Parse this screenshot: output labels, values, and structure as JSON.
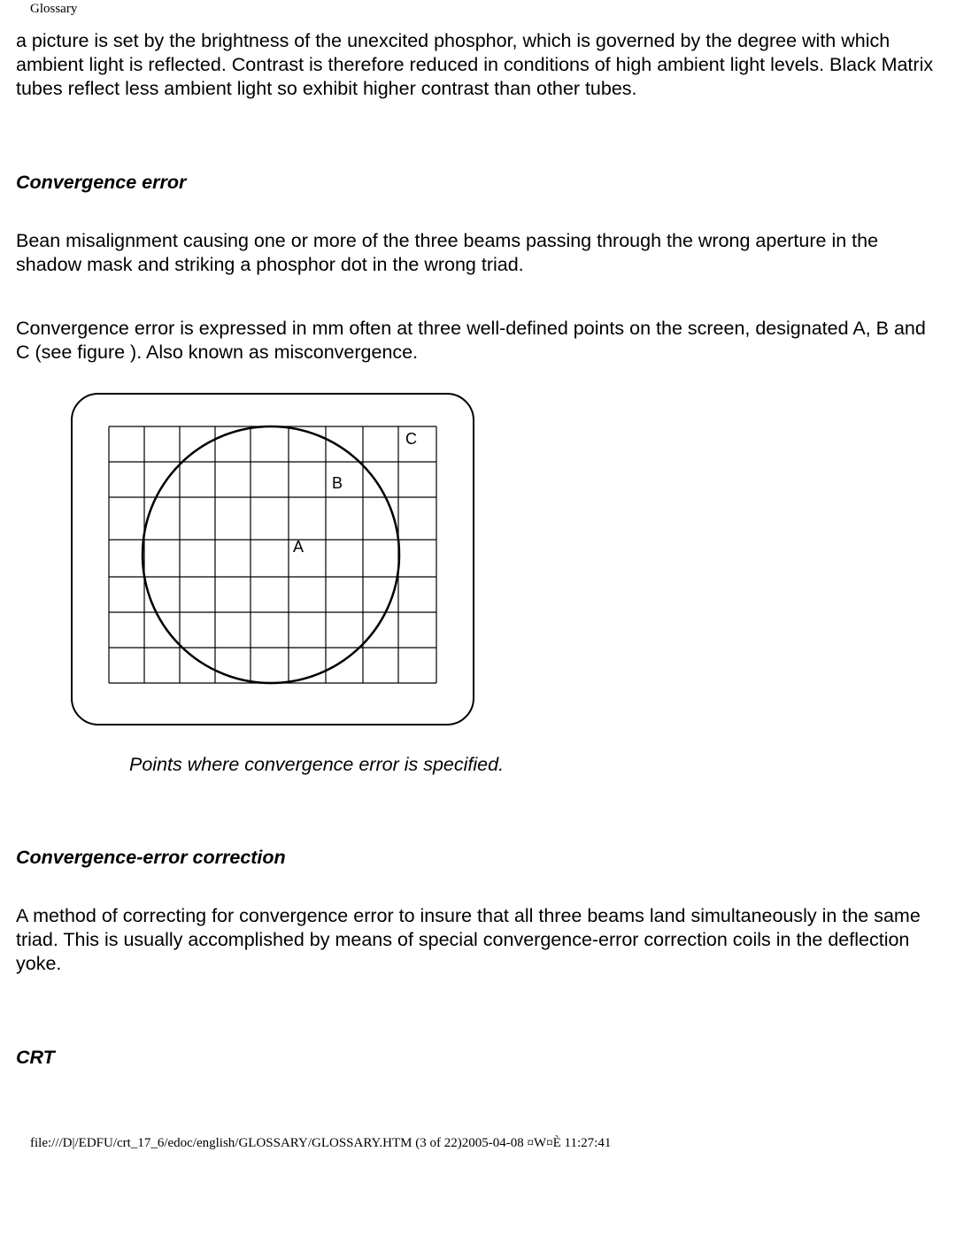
{
  "header": {
    "title": "Glossary"
  },
  "intro": {
    "paragraph": "a picture is set by the brightness of the unexcited phosphor, which is governed by the degree with which ambient light is reflected. Contrast is therefore reduced in conditions of high ambient light levels. Black Matrix tubes reflect less ambient light so exhibit higher contrast than other tubes."
  },
  "sections": {
    "conv_error": {
      "title": "Convergence error",
      "p1": "Bean misalignment causing one or more of the three beams passing through the wrong aperture in the shadow mask and striking a phosphor dot in the wrong triad.",
      "p2": "Convergence error is expressed in mm often at three well-defined points on the screen, designated A, B and C (see figure ). Also known as misconvergence.",
      "caption": "Points where convergence error is specified."
    },
    "conv_err_correction": {
      "title": "Convergence-error correction",
      "p1": "A method of correcting for convergence error to insure that all three beams land simultaneously in the same triad. This is usually accomplished by means of special convergence-error correction coils in the deflection yoke."
    },
    "crt": {
      "title": "CRT"
    }
  },
  "figure": {
    "label_a": "A",
    "label_b": "B",
    "label_c": "C"
  },
  "footer": {
    "text": "file:///D|/EDFU/crt_17_6/edoc/english/GLOSSARY/GLOSSARY.HTM (3 of 22)2005-04-08 ¤W¤È 11:27:41"
  }
}
